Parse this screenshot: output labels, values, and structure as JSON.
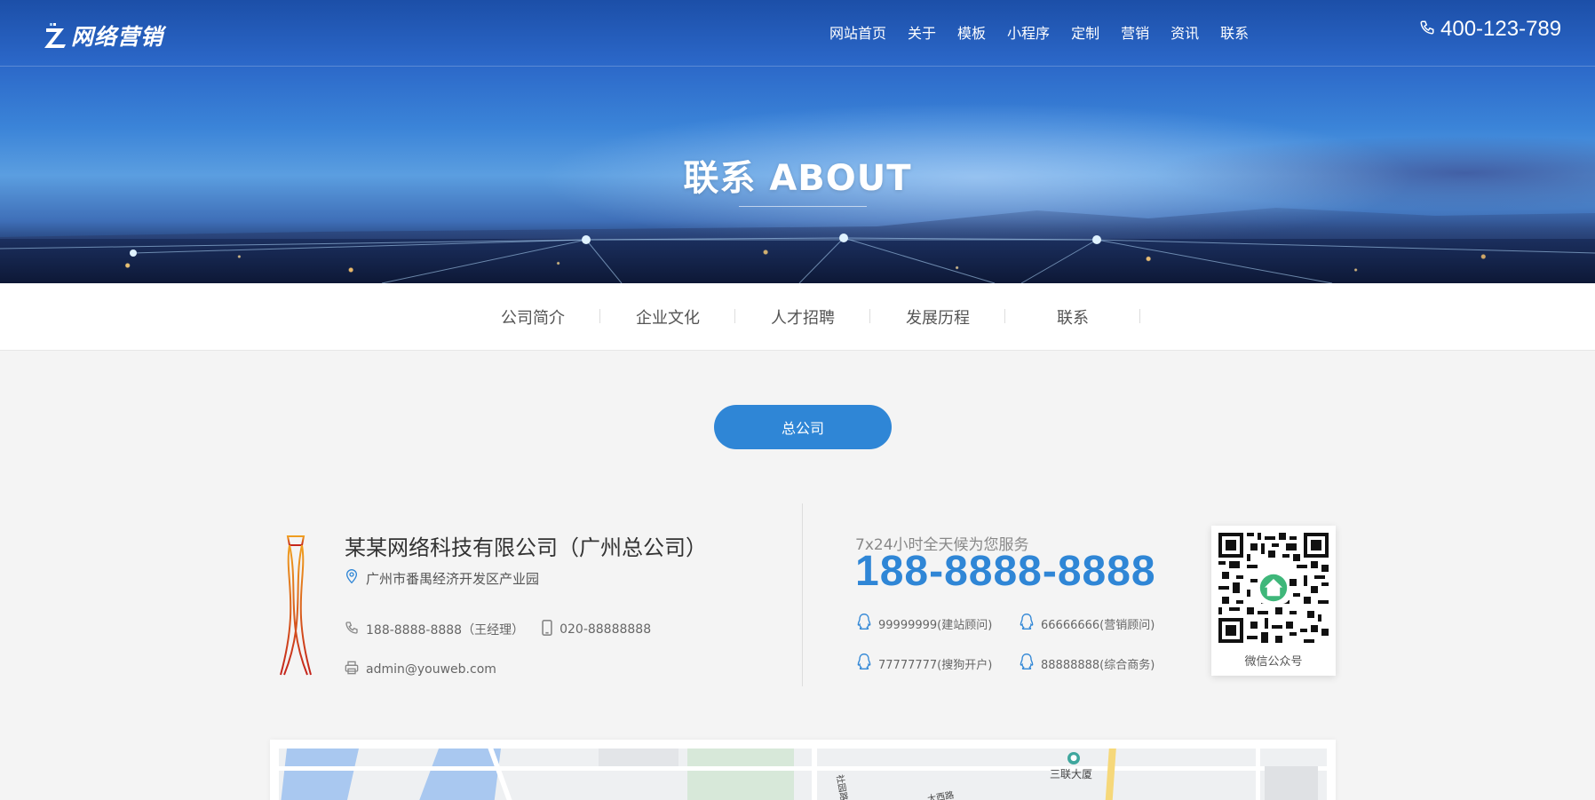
{
  "header": {
    "logo_text": "网络营销",
    "nav": [
      "网站首页",
      "关于",
      "模板",
      "小程序",
      "定制",
      "营销",
      "资讯",
      "联系"
    ],
    "phone": "400-123-789"
  },
  "banner": {
    "title": "联系 ABOUT"
  },
  "subnav": [
    "公司简介",
    "企业文化",
    "人才招聘",
    "发展历程",
    "联系"
  ],
  "branch_button": "总公司",
  "company": {
    "name": "某某网络科技有限公司（广州总公司）",
    "address": "广州市番禺经济开发区产业园",
    "phone": "188-8888-8888（王经理）",
    "tel": "020-88888888",
    "email": "admin@youweb.com"
  },
  "service": {
    "tagline": "7x24小时全天候为您服务",
    "hotline": "188-8888-8888",
    "qq": [
      "99999999(建站顾问)",
      "66666666(营销顾问)",
      "77777777(搜狗开户)",
      "88888888(综合商务)"
    ],
    "qr_caption": "微信公众号"
  },
  "map": {
    "poi_label": "三联大厦",
    "road_label_1": "社园路",
    "road_label_2": "大西路"
  },
  "colors": {
    "accent": "#2f86d6",
    "header_bg": "#2b67c8",
    "page_bg": "#f4f4f4"
  }
}
